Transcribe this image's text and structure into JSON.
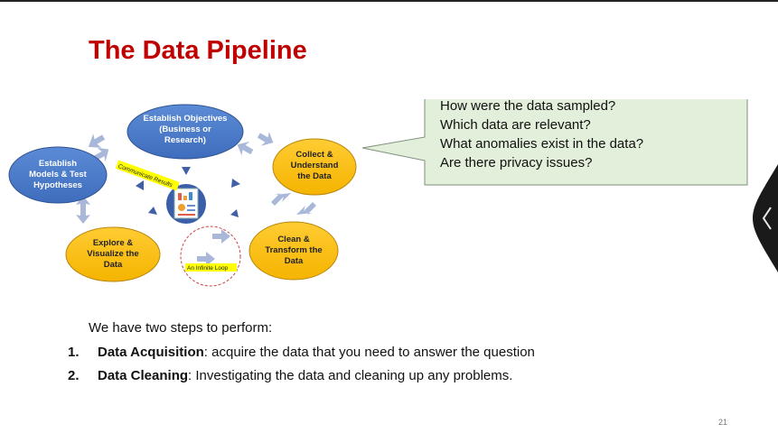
{
  "slide": {
    "title": "The Data Pipeline",
    "page_number": "21"
  },
  "diagram": {
    "nodes": {
      "objectives": [
        "Establish Objectives",
        "(Business or",
        "Research)"
      ],
      "collect": [
        "Collect &",
        "Understand",
        "the Data"
      ],
      "clean": [
        "Clean &",
        "Transform the",
        "Data"
      ],
      "explore": [
        "Explore &",
        "Visualize the",
        "Data"
      ],
      "models": [
        "Establish",
        "Models & Test",
        "Hypotheses"
      ]
    },
    "labels": {
      "communicate": "Communicate Results",
      "loop": "An Infinite Loop"
    },
    "colors": {
      "blue_node": "#4472c4",
      "orange_node": "#ffc000",
      "arrow": "#a9b7d9",
      "highlight": "#ffff00"
    }
  },
  "callout": {
    "lines": [
      "How were the data sampled?",
      "Which data are relevant?",
      "What anomalies exist in the data?",
      "Are there privacy issues?"
    ],
    "fill": "#e2efda"
  },
  "body": {
    "intro": "We have two steps to perform:",
    "steps": [
      {
        "num": "1.",
        "term": "Data Acquisition",
        "desc": ": acquire the data that you need to answer the question"
      },
      {
        "num": "2.",
        "term": "Data Cleaning",
        "desc": ": Investigating the data and cleaning up any problems."
      }
    ]
  }
}
